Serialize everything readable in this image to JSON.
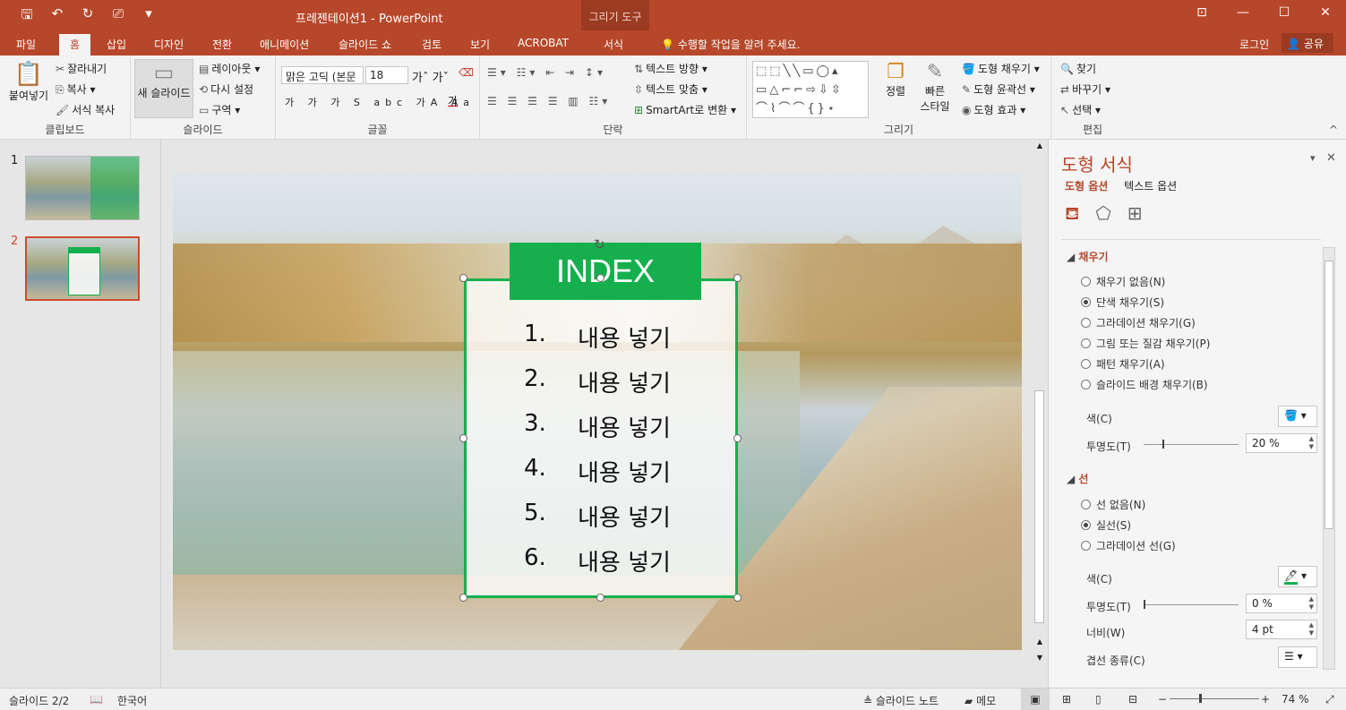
{
  "app": {
    "doc_title": "프레젠테이션1 - PowerPoint",
    "context_tab_group": "그리기 도구",
    "qat": [
      "save-icon",
      "undo-icon",
      "redo-icon",
      "present-icon",
      "customize-icon"
    ]
  },
  "tabs": [
    "파일",
    "홈",
    "삽입",
    "디자인",
    "전환",
    "애니메이션",
    "슬라이드 쇼",
    "검토",
    "보기",
    "ACROBAT",
    "서식"
  ],
  "tell_me": "수행할 작업을 알려 주세요.",
  "sign_in": "로그인",
  "share": "공유",
  "ribbon": {
    "clipboard": {
      "paste": "붙여넣기",
      "cut": "잘라내기",
      "copy": "복사",
      "format_painter": "서식 복사",
      "label": "클립보드"
    },
    "slides": {
      "new_slide": "새 슬라이드",
      "layout": "레이아웃",
      "reset": "다시 설정",
      "section": "구역",
      "label": "슬라이드"
    },
    "font": {
      "font_name": "맑은 고딕 (본문",
      "font_size": "18",
      "label": "글꼴"
    },
    "paragraph": {
      "text_direction": "텍스트 방향",
      "align_text": "텍스트 맞춤",
      "smartart": "SmartArt로 변환",
      "label": "단락"
    },
    "drawing": {
      "arrange": "정렬",
      "quick_styles_1": "빠른",
      "quick_styles_2": "스타일",
      "shape_fill": "도형 채우기",
      "shape_outline": "도형 윤곽선",
      "shape_effects": "도형 효과",
      "label": "그리기"
    },
    "editing": {
      "find": "찾기",
      "replace": "바꾸기",
      "select": "선택",
      "label": "편집"
    }
  },
  "thumbnails": [
    {
      "num": "1"
    },
    {
      "num": "2"
    }
  ],
  "slide": {
    "index_title": "INDEX",
    "items": [
      {
        "num": "1.",
        "text": "내용 넣기"
      },
      {
        "num": "2.",
        "text": "내용 넣기"
      },
      {
        "num": "3.",
        "text": "내용 넣기"
      },
      {
        "num": "4.",
        "text": "내용 넣기"
      },
      {
        "num": "5.",
        "text": "내용 넣기"
      },
      {
        "num": "6.",
        "text": "내용 넣기"
      }
    ]
  },
  "pane": {
    "title": "도형 서식",
    "tab_shape": "도형 옵션",
    "tab_text": "텍스트 옵션",
    "fill": {
      "heading": "채우기",
      "options": [
        "채우기 없음(N)",
        "단색 채우기(S)",
        "그라데이션 채우기(G)",
        "그림 또는 질감 채우기(P)",
        "패턴 채우기(A)",
        "슬라이드 배경 채우기(B)"
      ],
      "selected": 1,
      "color_label": "색(C)",
      "transparency_label": "투명도(T)",
      "transparency_value": "20 %",
      "transparency_level": 0.2
    },
    "line": {
      "heading": "선",
      "options": [
        "선 없음(N)",
        "실선(S)",
        "그라데이션 선(G)"
      ],
      "selected": 1,
      "color_label": "색(C)",
      "transparency_label": "투명도(T)",
      "transparency_value": "0 %",
      "transparency_level": 0,
      "width_label": "너비(W)",
      "width_value": "4 pt",
      "compound_label": "겹선 종류(C)"
    }
  },
  "status": {
    "slide_count": "슬라이드 2/2",
    "language": "한국어",
    "notes": "슬라이드 노트",
    "comments": "메모",
    "zoom": "74 %"
  },
  "colors": {
    "accent": "#b7472a",
    "green": "#15b04d"
  }
}
